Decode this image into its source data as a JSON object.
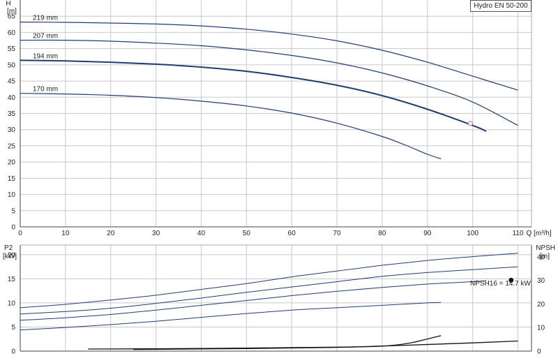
{
  "chart_data": [
    {
      "type": "line",
      "title": "",
      "legend_label": "Hydro EN 50-200",
      "xlabel": "Q [m³/h]",
      "ylabel_line1": "H",
      "ylabel_line2": "[m]",
      "xlim": [
        0,
        113
      ],
      "ylim": [
        0,
        70
      ],
      "x_ticks": [
        0,
        10,
        20,
        30,
        40,
        50,
        60,
        70,
        80,
        90,
        100,
        110
      ],
      "y_ticks": [
        0,
        5,
        10,
        15,
        20,
        25,
        30,
        35,
        40,
        45,
        50,
        55,
        60,
        65
      ],
      "grid": true,
      "color": "#1f3d73",
      "series": [
        {
          "name": "219 mm",
          "x": [
            0,
            10,
            20,
            30,
            40,
            50,
            60,
            70,
            80,
            90,
            100,
            110
          ],
          "y": [
            63.2,
            63.1,
            62.9,
            62.6,
            62.0,
            61.0,
            59.5,
            57.4,
            54.5,
            50.8,
            46.5,
            42.2
          ]
        },
        {
          "name": "207 mm",
          "x": [
            0,
            10,
            20,
            30,
            40,
            50,
            60,
            70,
            80,
            90,
            100,
            110
          ],
          "y": [
            57.6,
            57.6,
            57.3,
            56.7,
            55.9,
            54.6,
            52.9,
            50.6,
            47.5,
            43.5,
            38.5,
            31.3
          ]
        },
        {
          "name": "194 mm",
          "x": [
            0,
            10,
            20,
            30,
            40,
            50,
            60,
            70,
            80,
            90,
            100,
            103
          ],
          "y": [
            51.4,
            51.2,
            50.8,
            50.2,
            49.3,
            48.0,
            46.1,
            43.7,
            40.5,
            36.3,
            31.3,
            29.5
          ]
        },
        {
          "name": "170 mm",
          "x": [
            0,
            10,
            20,
            30,
            40,
            50,
            60,
            70,
            80,
            85,
            90,
            93
          ],
          "y": [
            41.2,
            41.0,
            40.6,
            39.9,
            38.8,
            37.3,
            35.1,
            32.0,
            27.9,
            25.3,
            22.4,
            21.0
          ]
        }
      ],
      "bold_series": "194 mm",
      "duty_point": {
        "x": 99.5,
        "y": 31.9
      }
    },
    {
      "type": "line",
      "title": "",
      "ylabel_left_line1": "P2",
      "ylabel_left_line2": "[kW]",
      "ylabel_right_line1": "NPSH",
      "ylabel_right_line2": "[m]",
      "xlim": [
        0,
        113
      ],
      "ylim_left": [
        0,
        22
      ],
      "ylim_right": [
        0,
        45
      ],
      "x_ticks": [
        0,
        10,
        20,
        30,
        40,
        50,
        60,
        70,
        80,
        90,
        100,
        110
      ],
      "y_ticks_left": [
        0,
        5,
        10,
        15,
        20
      ],
      "y_ticks_right": [
        0,
        10,
        20,
        30,
        40
      ],
      "grid": true,
      "annotation": "NPSH16 = 14.7 kW",
      "power_series": [
        {
          "name": "219 mm",
          "x": [
            0,
            10,
            20,
            30,
            40,
            50,
            60,
            70,
            80,
            90,
            100,
            110
          ],
          "y": [
            9.0,
            9.7,
            10.6,
            11.6,
            12.8,
            14.0,
            15.4,
            16.6,
            17.8,
            18.8,
            19.6,
            20.3
          ]
        },
        {
          "name": "207 mm",
          "x": [
            0,
            10,
            20,
            30,
            40,
            50,
            60,
            70,
            80,
            90,
            100,
            110
          ],
          "y": [
            7.7,
            8.2,
            8.9,
            9.9,
            11.0,
            12.2,
            13.3,
            14.4,
            15.5,
            16.3,
            16.9,
            17.5
          ]
        },
        {
          "name": "194 mm",
          "x": [
            0,
            10,
            20,
            30,
            40,
            50,
            60,
            70,
            80,
            90,
            100,
            103
          ],
          "y": [
            6.4,
            6.9,
            7.6,
            8.5,
            9.5,
            10.5,
            11.5,
            12.4,
            13.2,
            13.9,
            14.4,
            14.6
          ]
        },
        {
          "name": "170 mm",
          "x": [
            0,
            10,
            20,
            30,
            40,
            50,
            60,
            70,
            80,
            90,
            93
          ],
          "y": [
            4.4,
            4.9,
            5.5,
            6.2,
            7.0,
            7.8,
            8.5,
            9.0,
            9.5,
            10.0,
            10.1
          ]
        }
      ],
      "npsh_series": [
        {
          "name": "npsh-a",
          "x": [
            15,
            30,
            50,
            70,
            80,
            86,
            93
          ],
          "y": [
            0.9,
            1.0,
            1.3,
            1.7,
            2.1,
            3.4,
            6.6
          ]
        },
        {
          "name": "npsh-b",
          "x": [
            25,
            50,
            70,
            85,
            100,
            110
          ],
          "y": [
            0.7,
            1.1,
            1.6,
            2.5,
            3.5,
            4.3
          ]
        }
      ],
      "marker_point": {
        "x": 108.5,
        "y": 14.7
      }
    }
  ]
}
